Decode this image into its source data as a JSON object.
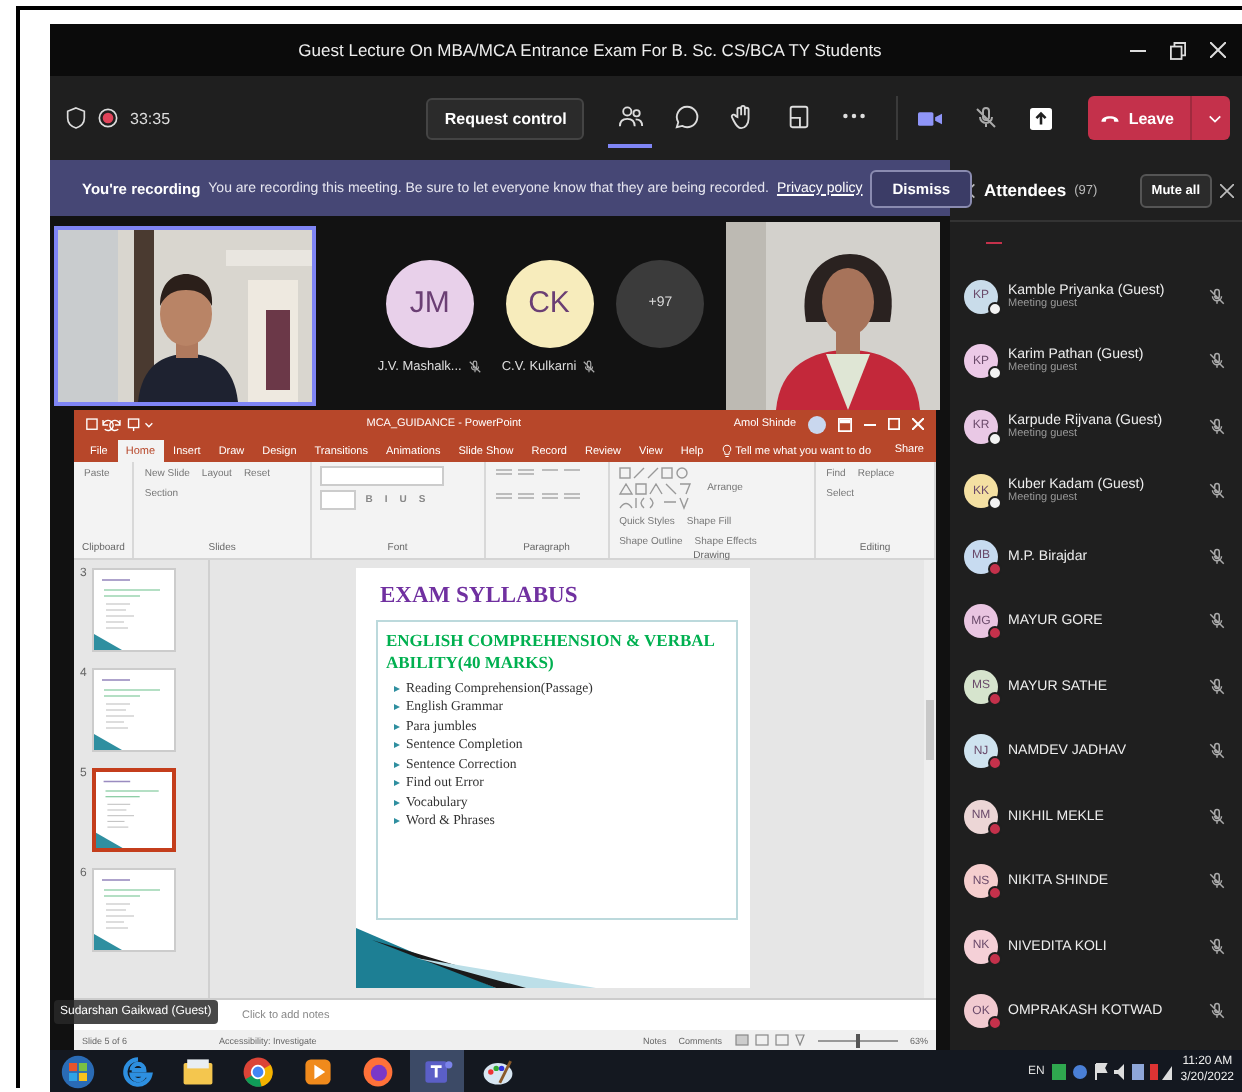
{
  "window": {
    "title": "Guest Lecture On MBA/MCA Entrance Exam For B. Sc. CS/BCA TY Students"
  },
  "toolbar": {
    "timer": "33:35",
    "request_control": "Request control",
    "tools": [
      {
        "kind": "people",
        "selected": true
      },
      {
        "kind": "chat",
        "selected": false
      },
      {
        "kind": "hand",
        "selected": false
      },
      {
        "kind": "rooms",
        "selected": false
      },
      {
        "kind": "more",
        "selected": false
      }
    ],
    "leave": "Leave"
  },
  "recording_banner": {
    "title": "You're recording",
    "message": "You are recording this meeting. Be sure to let everyone know that they are being recorded.",
    "link": "Privacy policy",
    "button": "Dismiss"
  },
  "stage": {
    "participants": [
      {
        "initials": "JM",
        "name": "J.V. Mashalk...",
        "color": "#e8d0ea"
      },
      {
        "initials": "CK",
        "name": "C.V. Kulkarni",
        "color": "#f7ecbc"
      }
    ],
    "overflow": "+97",
    "sharer": "Sudarshan Gaikwad (Guest)"
  },
  "powerpoint": {
    "title": "MCA_GUIDANCE - PowerPoint",
    "user": "Amol Shinde",
    "tabs": [
      {
        "label": "File",
        "selected": false
      },
      {
        "label": "Home",
        "selected": true
      },
      {
        "label": "Insert",
        "selected": false
      },
      {
        "label": "Draw",
        "selected": false
      },
      {
        "label": "Design",
        "selected": false
      },
      {
        "label": "Transitions",
        "selected": false
      },
      {
        "label": "Animations",
        "selected": false
      },
      {
        "label": "Slide Show",
        "selected": false
      },
      {
        "label": "Record",
        "selected": false
      },
      {
        "label": "Review",
        "selected": false
      },
      {
        "label": "View",
        "selected": false
      },
      {
        "label": "Help",
        "selected": false
      }
    ],
    "tell_me": "Tell me what you want to do",
    "share": "Share",
    "ribbon": [
      {
        "label": "Clipboard",
        "buttons": [
          "Paste"
        ]
      },
      {
        "label": "Slides",
        "buttons": [
          "New Slide",
          "Layout",
          "Reset",
          "Section"
        ]
      },
      {
        "label": "Font",
        "buttons": [
          "B",
          "I",
          "U",
          "S"
        ]
      },
      {
        "label": "Paragraph"
      },
      {
        "label": "Drawing",
        "buttons": [
          "Arrange",
          "Quick Styles",
          "Shape Fill",
          "Shape Outline",
          "Shape Effects"
        ]
      },
      {
        "label": "Editing",
        "buttons": [
          "Find",
          "Replace",
          "Select"
        ]
      }
    ],
    "thumbnails": [
      {
        "number": "3",
        "selected": false
      },
      {
        "number": "4",
        "selected": false
      },
      {
        "number": "5",
        "selected": true
      },
      {
        "number": "6",
        "selected": false
      }
    ],
    "slide": {
      "title": "EXAM SYLLABUS",
      "heading": "ENGLISH COMPREHENSION & VERBAL ABILITY(40 MARKS)",
      "bullets": [
        "Reading Comprehension(Passage)",
        "English Grammar",
        "Para jumbles",
        "Sentence Completion",
        "Sentence Correction",
        "Find out Error",
        "Vocabulary",
        "Word & Phrases"
      ]
    },
    "notes_placeholder": "Click to add notes",
    "status": {
      "slide_count": "Slide 5 of 6",
      "accessibility": "Accessibility: Investigate",
      "notes": "Notes",
      "comments": "Comments",
      "zoom": "63%",
      "zoom_slider": {
        "level": 0.5
      }
    }
  },
  "attendees": {
    "title": "Attendees",
    "count": "(97)",
    "mute_all": "Mute all",
    "people": [
      {
        "initials": "KP",
        "name": "Kamble Priyanka (Guest)",
        "subtitle": "Meeting guest",
        "color": "#c9dcea",
        "busy": false
      },
      {
        "initials": "KP",
        "name": "Karim Pathan (Guest)",
        "subtitle": "Meeting guest",
        "color": "#ecc9e7",
        "busy": false
      },
      {
        "initials": "KR",
        "name": "Karpude Rijvana (Guest)",
        "subtitle": "Meeting guest",
        "color": "#e9c8e5",
        "busy": false
      },
      {
        "initials": "KK",
        "name": "Kuber Kadam (Guest)",
        "subtitle": "Meeting guest",
        "color": "#f4e0a2",
        "busy": false
      },
      {
        "initials": "MB",
        "name": "M.P. Birajdar",
        "color": "#c7dbf0",
        "busy": true
      },
      {
        "initials": "MG",
        "name": "MAYUR GORE",
        "color": "#e9c5e1",
        "busy": true
      },
      {
        "initials": "MS",
        "name": "MAYUR SATHE",
        "color": "#d6e4cd",
        "busy": true
      },
      {
        "initials": "NJ",
        "name": "NAMDEV JADHAV",
        "color": "#cfe3ef",
        "busy": true
      },
      {
        "initials": "NM",
        "name": "NIKHIL MEKLE",
        "color": "#ecd6d6",
        "busy": true
      },
      {
        "initials": "NS",
        "name": "NIKITA SHINDE",
        "color": "#f5cece",
        "busy": true
      },
      {
        "initials": "NK",
        "name": "NIVEDITA KOLI",
        "color": "#f5d0d7",
        "busy": true
      },
      {
        "initials": "OK",
        "name": "OMPRAKASH KOTWAD",
        "color": "#f1cad0",
        "busy": true
      }
    ]
  },
  "taskbar": {
    "apps": [
      {
        "kind": "start",
        "selected": false
      },
      {
        "kind": "browser",
        "selected": false
      },
      {
        "kind": "folder",
        "selected": false
      },
      {
        "kind": "chrome",
        "selected": false
      },
      {
        "kind": "media",
        "selected": false
      },
      {
        "kind": "firefox",
        "selected": false
      },
      {
        "kind": "teams",
        "selected": true
      },
      {
        "kind": "paint",
        "selected": false
      }
    ],
    "language": "EN",
    "time": "11:20 AM",
    "date": "3/20/2022"
  }
}
